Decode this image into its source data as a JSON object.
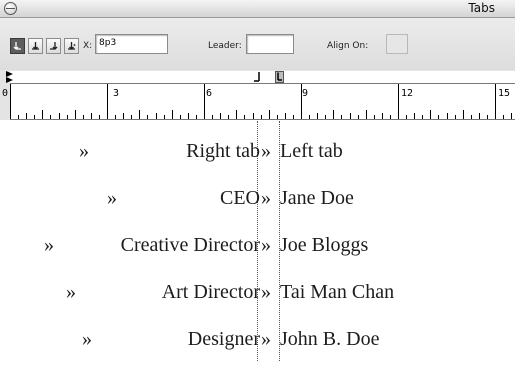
{
  "palette": {
    "title": "Tabs",
    "toolbar": {
      "x_label": "X:",
      "x_value": "8p3",
      "leader_label": "Leader:",
      "leader_value": "",
      "align_on_label": "Align On:",
      "align_on_value": ""
    },
    "tab_buttons": [
      {
        "icon": "left-justified-tab-icon",
        "active": true
      },
      {
        "icon": "center-justified-tab-icon",
        "active": false
      },
      {
        "icon": "right-justified-tab-icon",
        "active": false
      },
      {
        "icon": "align-to-decimal-tab-icon",
        "active": false
      }
    ],
    "ruler_numbers": [
      "0",
      "3",
      "6",
      "9",
      "12",
      "15"
    ]
  },
  "document": {
    "tab_marker": "»",
    "rows": [
      {
        "left": "Right tab",
        "right": "Left tab"
      },
      {
        "left": "CEO",
        "right": "Jane Doe"
      },
      {
        "left": "Creative Director",
        "right": "Joe Bloggs"
      },
      {
        "left": "Art Director",
        "right": "Tai Man Chan"
      },
      {
        "left": "Designer",
        "right": "John B. Doe"
      }
    ]
  },
  "colors": {
    "active_button": "#5d5d5d",
    "text": "#1d1d1d"
  }
}
